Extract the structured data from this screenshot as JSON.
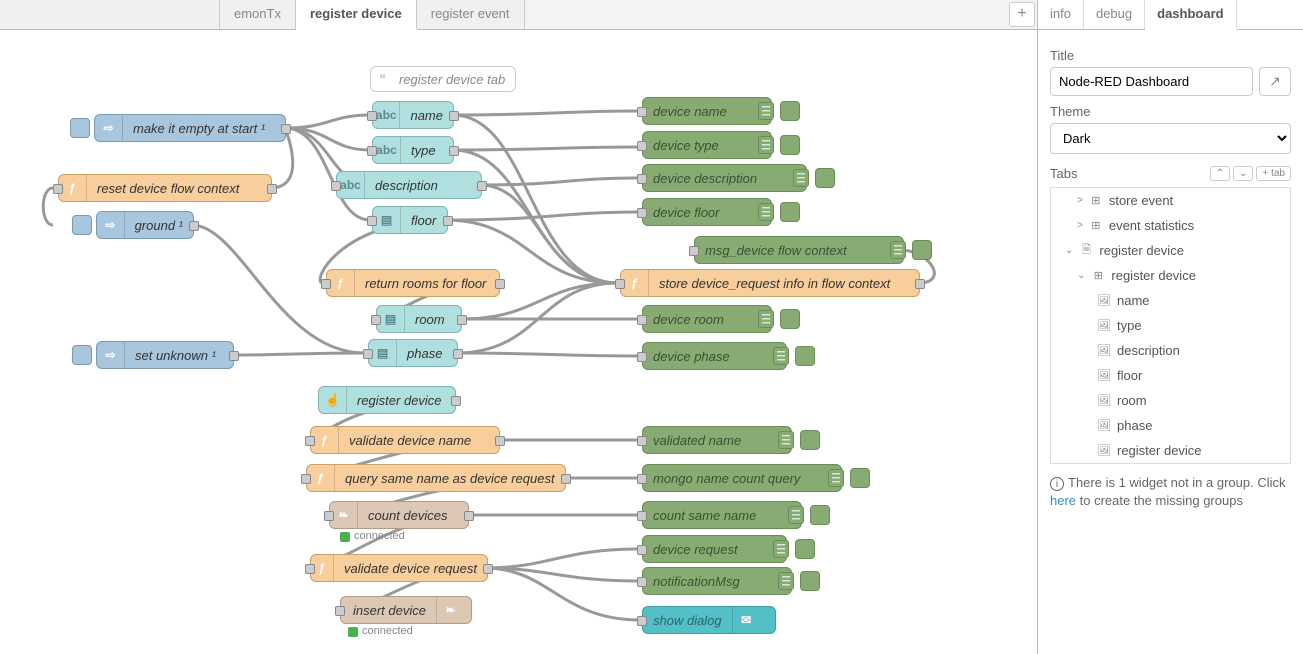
{
  "topTabs": {
    "items": [
      {
        "label": "",
        "active": false,
        "empty": true
      },
      {
        "label": "emonTx",
        "active": false
      },
      {
        "label": "register device",
        "active": true
      },
      {
        "label": "register event",
        "active": false
      }
    ],
    "add": "+"
  },
  "comment": "register device tab",
  "nodes": {
    "makeEmpty": "make it empty at start ¹",
    "resetFlow": "reset device flow context",
    "ground": "ground ¹",
    "setUnknown": "set unknown ¹",
    "name": "name",
    "type": "type",
    "description": "description",
    "floor": "floor",
    "returnRooms": "return rooms for floor",
    "room": "room",
    "phase": "phase",
    "registerDevice": "register device",
    "validateName": "validate device name",
    "querySameName": "query same name as device request",
    "countDevices": "count devices",
    "validateRequest": "validate device request",
    "insertDevice": "insert device",
    "dbgDeviceName": "device name",
    "dbgDeviceType": "device type",
    "dbgDeviceDesc": "device description",
    "dbgDeviceFloor": "device floor",
    "dbgMsgFlow": "msg_device flow context",
    "storeRequest": "store device_request info in flow context",
    "dbgDeviceRoom": "device room",
    "dbgDevicePhase": "device phase",
    "dbgValidatedName": "validated name",
    "dbgMongoQuery": "mongo name count query",
    "dbgCountSame": "count same name",
    "dbgDeviceRequest": "device request",
    "dbgNotification": "notificationMsg",
    "showDialog": "show dialog",
    "connected": "connected"
  },
  "icons": {
    "abc": "abc",
    "fn": "ƒ",
    "arrow": "⇨",
    "form": "▤",
    "hand": "☝",
    "leaf": "❧",
    "mail": "✉"
  },
  "sidebar": {
    "tabs": [
      {
        "label": "info",
        "active": false
      },
      {
        "label": "debug",
        "active": false
      },
      {
        "label": "dashboard",
        "active": true
      }
    ],
    "titleLabel": "Title",
    "titleValue": "Node-RED Dashboard",
    "themeLabel": "Theme",
    "themeValue": "Dark",
    "tabsLabel": "Tabs",
    "miniBtns": [
      "⌃",
      "⌄",
      "+ tab"
    ],
    "tree": [
      {
        "type": "group",
        "caret": ">",
        "icon": "⊞",
        "label": "store event",
        "indent": 1
      },
      {
        "type": "group",
        "caret": ">",
        "icon": "⊞",
        "label": "event statistics",
        "indent": 1
      },
      {
        "type": "tab",
        "caret": "⌄",
        "icon": "🗎",
        "label": "register device",
        "indent": 0
      },
      {
        "type": "group",
        "caret": "⌄",
        "icon": "⊞",
        "label": "register device",
        "indent": 1
      },
      {
        "type": "widget",
        "icon": "🖼",
        "label": "name",
        "indent": 2
      },
      {
        "type": "widget",
        "icon": "🖼",
        "label": "type",
        "indent": 2
      },
      {
        "type": "widget",
        "icon": "🖼",
        "label": "description",
        "indent": 2
      },
      {
        "type": "widget",
        "icon": "🖼",
        "label": "floor",
        "indent": 2
      },
      {
        "type": "widget",
        "icon": "🖼",
        "label": "room",
        "indent": 2
      },
      {
        "type": "widget",
        "icon": "🖼",
        "label": "phase",
        "indent": 2
      },
      {
        "type": "widget",
        "icon": "🖼",
        "label": "register device",
        "indent": 2
      }
    ],
    "noticePrefix": "There is 1 widget not in a group. Click ",
    "noticeLink": "here",
    "noticeSuffix": " to create the missing groups"
  }
}
